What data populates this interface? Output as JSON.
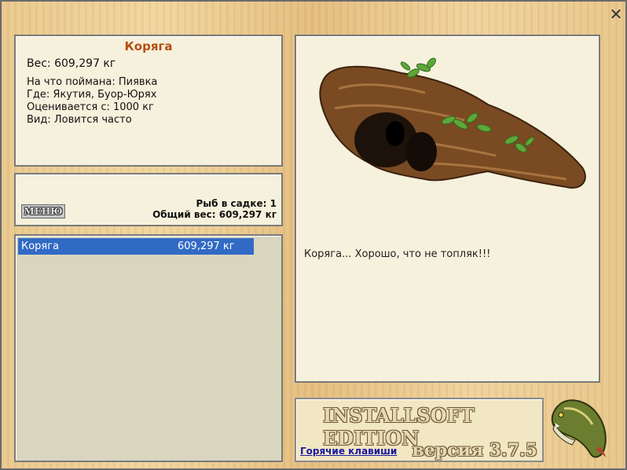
{
  "close_icon": "close-icon",
  "info": {
    "title": "Коряга",
    "weight": "Вес: 609,297 кг",
    "caught_on": "На что поймана: Пиявка",
    "where": "Где: Якутия, Буор-Юрях",
    "valued": "Оценивается с: 1000 кг",
    "kind": "Вид: Ловится часто"
  },
  "keepnet": {
    "menu_label": "МЕНЮ",
    "fish_count": "Рыб в садке: 1",
    "total_weight": "Общий вес: 609,297 кг"
  },
  "list": {
    "items": [
      {
        "name": "Коряга",
        "weight": "609,297 кг"
      }
    ]
  },
  "picture": {
    "icon": "driftwood-image",
    "description": "Коряга... Хорошо, что не топляк!!!"
  },
  "brand": {
    "edition": "INSTALLSOFT EDITION",
    "version": "версия 3.7.5",
    "hotkeys": "Горячие клавиши",
    "logo_icon": "pike-fish-icon"
  },
  "colors": {
    "title": "#b64d12",
    "selection": "#316ac5",
    "panel": "#f6f1dc"
  }
}
